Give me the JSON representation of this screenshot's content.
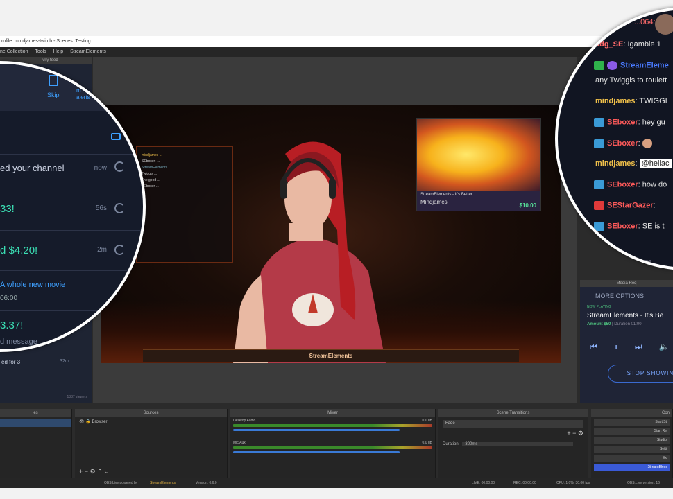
{
  "window": {
    "title": "rofile: mindjames-twitch - Scenes: Testing"
  },
  "menu": [
    "ne Collection",
    "Tools",
    "Help",
    "StreamElements"
  ],
  "activity_feed": {
    "dock_title": "ivity feed",
    "skip_label": "Skip",
    "mute_label_1": "m",
    "mute_label_2": "alerts",
    "rows": [
      {
        "text": "ed your channel",
        "time": "now"
      },
      {
        "text": "33!",
        "time": "56s"
      },
      {
        "text": "d $4.20!",
        "time": "2m"
      },
      {
        "text": "A whole new movie",
        "time": ""
      },
      {
        "text": "06:00",
        "time": ""
      },
      {
        "text": "3.37!",
        "time": ""
      },
      {
        "text": "d message",
        "time": ""
      },
      {
        "text": "ed for 3",
        "time": "32m"
      }
    ],
    "viewers": "1337 viewers"
  },
  "chat": {
    "messages": [
      {
        "user": "m",
        "text": "...064:",
        "color": "#ff6b6b"
      },
      {
        "user": "adg_SE",
        "text": ": Igamble 1",
        "color": "#ff6b6b"
      },
      {
        "user": "StreamEleme",
        "text": "",
        "color": "#4a7bff"
      },
      {
        "user": "",
        "text": "any Twiggis to roulett",
        "color": "#e6e6e6"
      },
      {
        "user": "mindjames",
        "text": ": TWIGGI",
        "color": "#f0c04a"
      },
      {
        "user": "SEboxer",
        "text": ": hey gu",
        "color": "#ff5a5a"
      },
      {
        "user": "SEboxer",
        "text": ":",
        "color": "#ff5a5a"
      },
      {
        "user": "mindjames",
        "text": ":",
        "color": "#f0c04a"
      },
      {
        "user": "SEboxer",
        "text": ": how do",
        "color": "#ff5a5a"
      },
      {
        "user": "SEStarGazer",
        "text": ":",
        "color": "#ff5a5a"
      },
      {
        "user": "SEboxer",
        "text": ": SE is t",
        "color": "#ff5a5a"
      }
    ],
    "mention": "@hellac",
    "message_placeholder": "age"
  },
  "scene_overlay": {
    "media_title": "StreamElements - It's Better",
    "media_user": "Mindjames",
    "media_price": "$10.00",
    "bottom_brand": "StreamElements"
  },
  "media_request": {
    "dock_title": "Media Req",
    "more_options": "MORE OPTIONS",
    "now_playing": "NOW PLAYING",
    "title": "StreamElements - It's Be",
    "amount": "Amount $50",
    "duration": "Duration 01:00",
    "stop": "STOP SHOWING"
  },
  "bottom": {
    "scenes_title": "es",
    "sources_title": "Sources",
    "source_item": "Browser",
    "mixer_title": "Mixer",
    "desktop_audio": "Desktop Audio",
    "desktop_db": "0.0 dB",
    "mic": "Mic/Aux",
    "mic_db": "0.0 dB",
    "transitions_title": "Scene Transitions",
    "transition": "Fade",
    "duration_label": "Duration",
    "duration_value": "300ms",
    "controls_title": "Con",
    "controls": [
      "Start St",
      "Start Re",
      "Studio",
      "Setti",
      "Ex",
      "StreamElem"
    ]
  },
  "status": {
    "live": "LIVE: 00:00:00",
    "rec": "REC: 00:00:00",
    "cpu": "CPU: 1.0%, 30.00 fps",
    "obs": "OBS.Live version: 16",
    "powered": "OBS.Live powered by",
    "brand": "StreamElements",
    "version": "Version: 0.6.0"
  },
  "colors": {
    "accent_blue": "#3a7ad6",
    "green": "#4ec27f"
  }
}
